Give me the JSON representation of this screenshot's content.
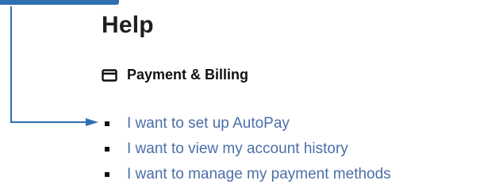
{
  "page": {
    "title": "Help"
  },
  "section": {
    "title": "Payment & Billing",
    "icon": "credit-card-icon"
  },
  "links": [
    {
      "label": "I want to set up AutoPay"
    },
    {
      "label": "I want to view my account history"
    },
    {
      "label": "I want to manage my payment methods"
    }
  ],
  "colors": {
    "link": "#4b6fa8",
    "callout": "#2f6fb1",
    "text": "#111111"
  }
}
